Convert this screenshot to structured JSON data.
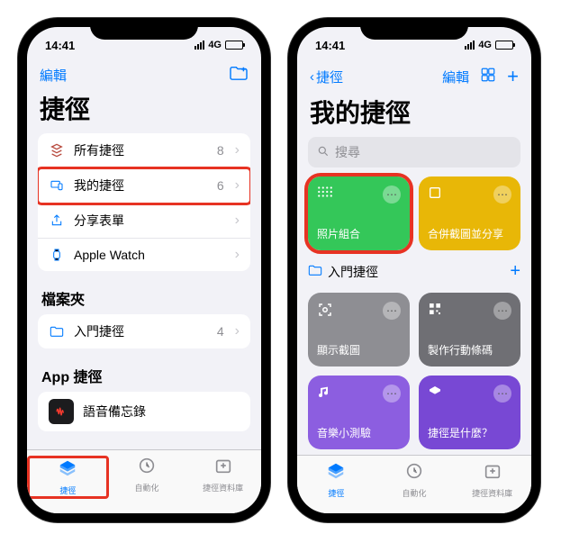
{
  "status": {
    "time": "14:41",
    "network": "4G"
  },
  "phone1": {
    "nav": {
      "edit": "編輯"
    },
    "title": "捷徑",
    "rows": [
      {
        "label": "所有捷徑",
        "count": "8"
      },
      {
        "label": "我的捷徑",
        "count": "6"
      },
      {
        "label": "分享表單",
        "count": ""
      },
      {
        "label": "Apple Watch",
        "count": ""
      }
    ],
    "folders_header": "檔案夾",
    "folders": [
      {
        "label": "入門捷徑",
        "count": "4"
      }
    ],
    "apps_header": "App 捷徑",
    "apps": [
      {
        "label": "語音備忘錄"
      }
    ]
  },
  "phone2": {
    "nav": {
      "back": "捷徑",
      "edit": "編輯"
    },
    "title": "我的捷徑",
    "search_placeholder": "搜尋",
    "top_cards": [
      {
        "label": "照片組合",
        "color": "green"
      },
      {
        "label": "合併截圖並分享",
        "color": "yellow"
      }
    ],
    "folder": {
      "label": "入門捷徑"
    },
    "cards": [
      {
        "label": "顯示截圖",
        "color": "gray"
      },
      {
        "label": "製作行動條碼",
        "color": "darkgray"
      },
      {
        "label": "音樂小測驗",
        "color": "purple"
      },
      {
        "label": "捷徑是什麼？",
        "color": "violet"
      }
    ]
  },
  "tabs": [
    {
      "label": "捷徑"
    },
    {
      "label": "自動化"
    },
    {
      "label": "捷徑資料庫"
    }
  ]
}
